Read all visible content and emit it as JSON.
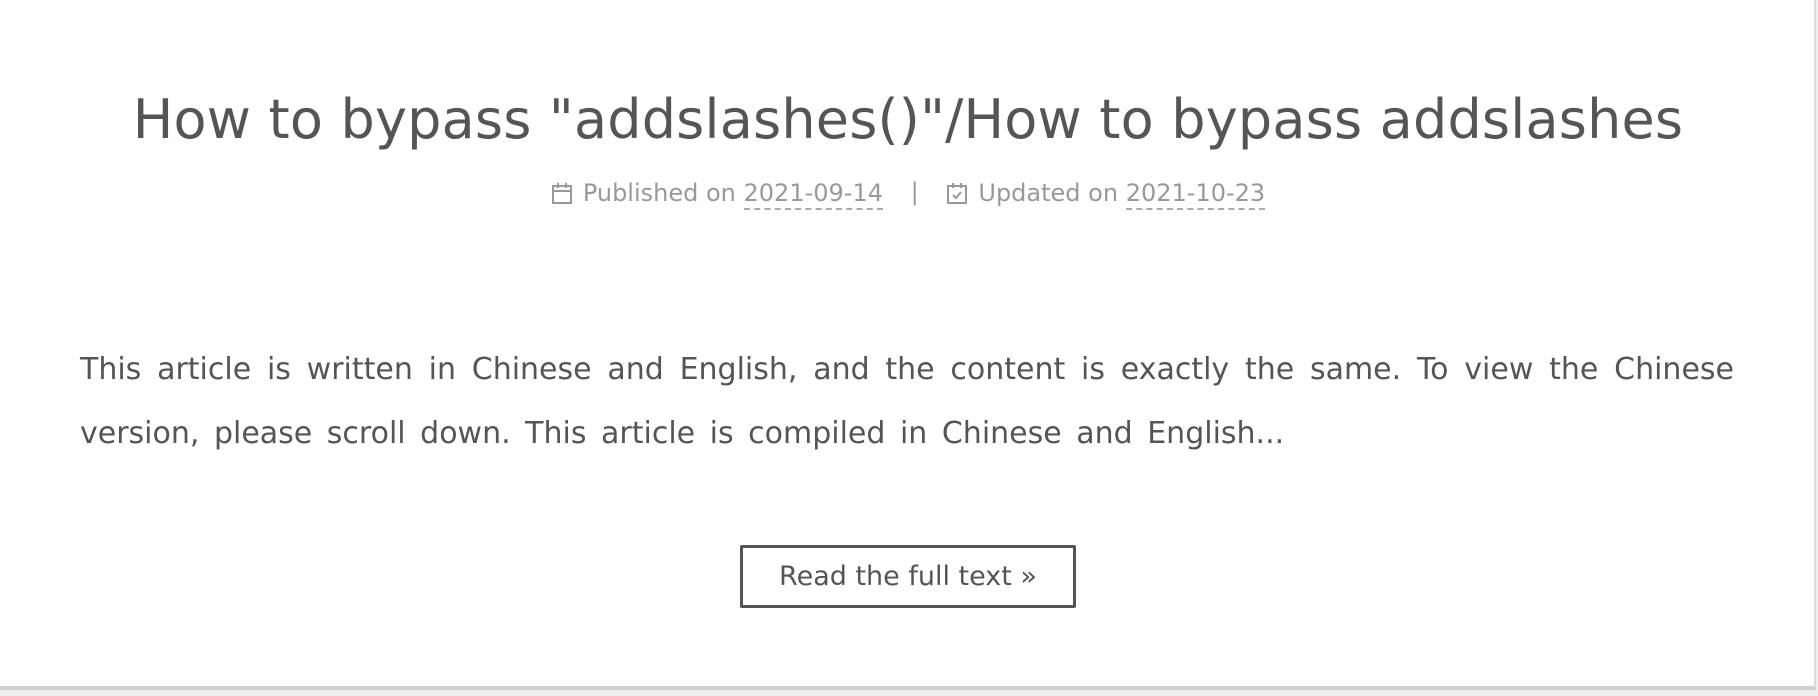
{
  "post": {
    "title": "How to bypass \"addslashes()\"/How to bypass addslashes",
    "meta": {
      "published_label": "Published on ",
      "published_date": "2021-09-14",
      "divider": "|",
      "updated_label": "Updated on ",
      "updated_date": "2021-10-23",
      "published_icon": "calendar-icon",
      "updated_icon": "calendar-check-icon"
    },
    "excerpt": "This article is written in Chinese and English, and the content is exactly the same. To view the Chinese version, please scroll down. This article is compiled in Chinese and English...",
    "read_more_label": "Read the full text »"
  },
  "colors": {
    "text": "#555555",
    "meta": "#999999",
    "background": "#ffffff"
  }
}
